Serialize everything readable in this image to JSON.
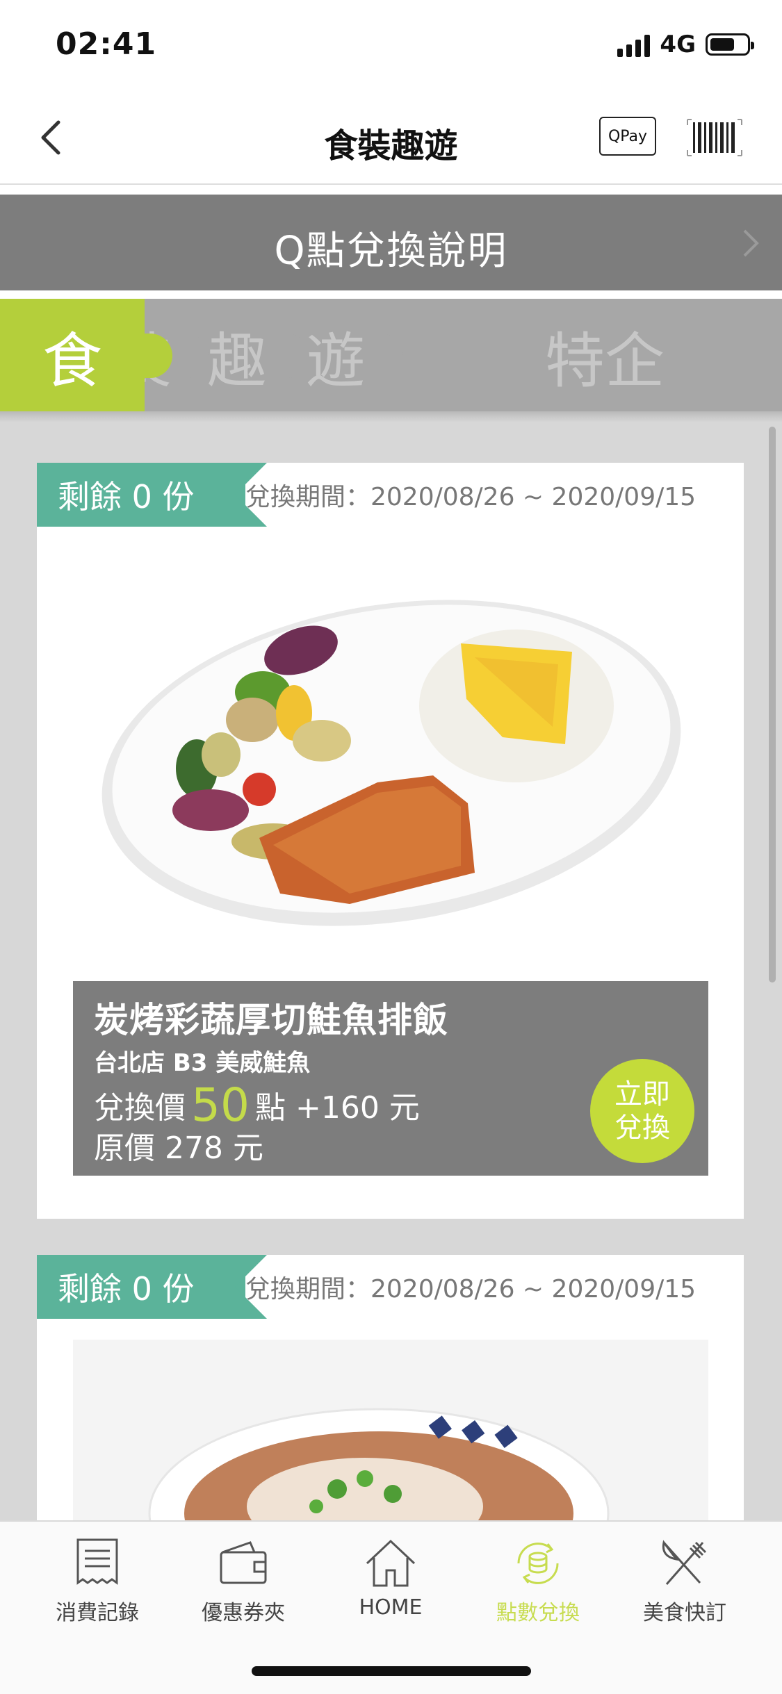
{
  "status_bar": {
    "time": "02:41",
    "network": "4G"
  },
  "nav": {
    "title": "食裝趣遊",
    "qpay_label": "QPay"
  },
  "info_banner": {
    "label": "Q點兌換說明"
  },
  "category_tabs": [
    {
      "label": "食",
      "active": true
    },
    {
      "label": "裝",
      "active": false
    },
    {
      "label": "趣",
      "active": false
    },
    {
      "label": "遊",
      "active": false
    },
    {
      "label": "特企",
      "active": false
    }
  ],
  "offers": [
    {
      "remaining": "剩餘 0 份",
      "period": "兌換期間：2020/08/26 ~ 2020/09/15",
      "name": "炭烤彩蔬厚切鮭魚排飯",
      "store": "台北店 B3 美威鮭魚",
      "price_prefix": "兌換價",
      "points": "50",
      "price_suffix": "點 +160 元",
      "original_price": "原價 278 元",
      "redeem_label_1": "立即",
      "redeem_label_2": "兌換"
    },
    {
      "remaining": "剩餘 0 份",
      "period": "兌換期間：2020/08/26 ~ 2020/09/15"
    }
  ],
  "tabbar": [
    {
      "label": "消費記錄",
      "icon": "receipt-icon",
      "active": false
    },
    {
      "label": "優惠券夾",
      "icon": "wallet-icon",
      "active": false
    },
    {
      "label": "HOME",
      "icon": "home-icon",
      "active": false
    },
    {
      "label": "點數兌換",
      "icon": "coin-exchange-icon",
      "active": true
    },
    {
      "label": "美食快訂",
      "icon": "fork-knife-icon",
      "active": false
    }
  ],
  "colors": {
    "accent_green": "#b4cf3b",
    "badge_teal": "#5bb39a",
    "banner_gray": "#7d7d7d",
    "points_yellow_green": "#c4db4a"
  }
}
